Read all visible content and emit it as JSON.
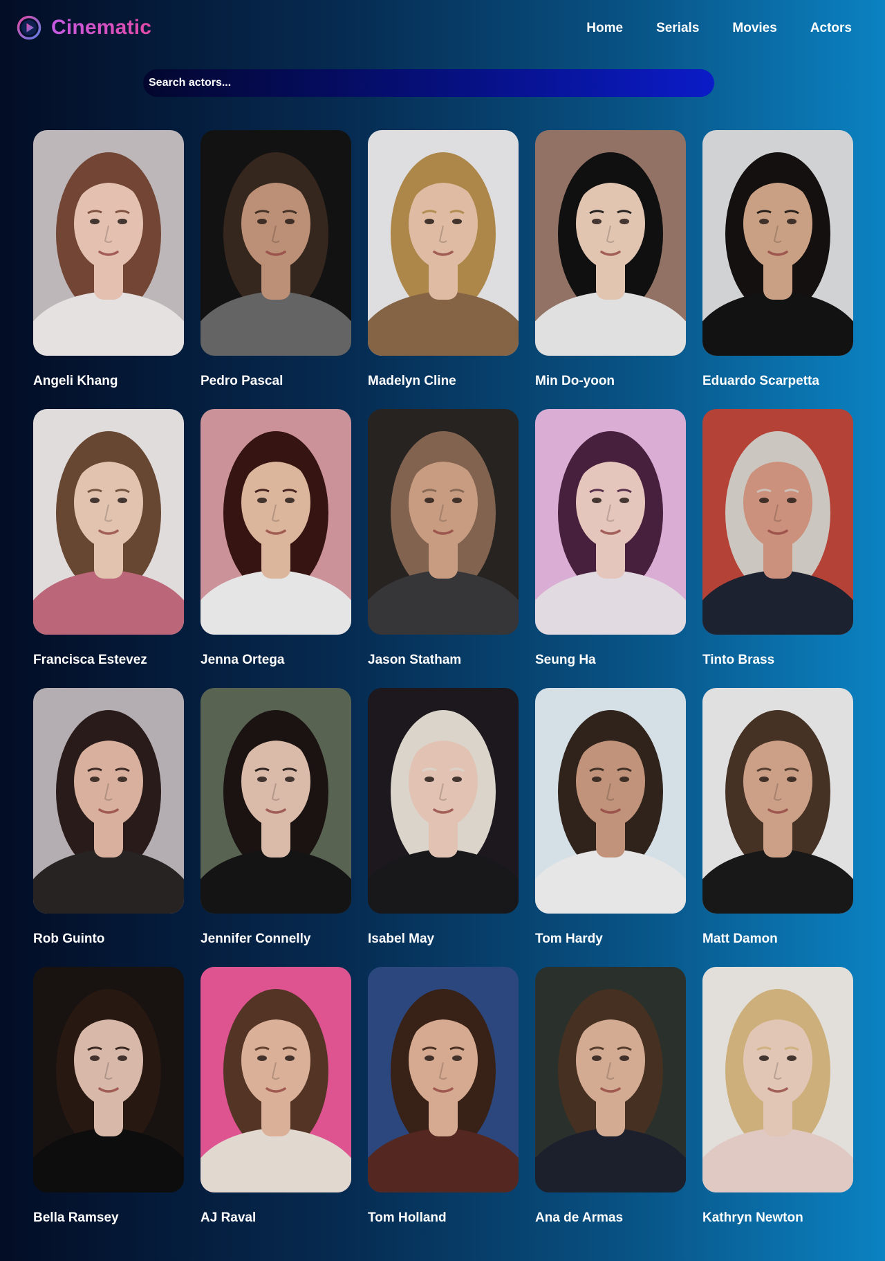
{
  "brand": {
    "name": "Cinematic",
    "icon": "play-circle-icon"
  },
  "nav": [
    {
      "label": "Home"
    },
    {
      "label": "Serials"
    },
    {
      "label": "Movies"
    },
    {
      "label": "Actors"
    }
  ],
  "search": {
    "placeholder": "Search actors...",
    "value": ""
  },
  "actors": [
    {
      "name": "Angeli Khang",
      "bg": "#c9c3c6",
      "skin": "#f2cdbb",
      "hair": "#7b4a38",
      "shirt": "#f4f0ee"
    },
    {
      "name": "Pedro Pascal",
      "bg": "#141414",
      "skin": "#c8997e",
      "hair": "#3a2a20",
      "shirt": "#6b6b6b"
    },
    {
      "name": "Madelyn Cline",
      "bg": "#ecebed",
      "skin": "#ecc7ad",
      "hair": "#b8904e",
      "shirt": "#8d6b4a"
    },
    {
      "name": "Min Do-yoon",
      "bg": "#9c7a6c",
      "skin": "#f0d2bd",
      "hair": "#121212",
      "shirt": "#eeeeee"
    },
    {
      "name": "Eduardo Scarpetta",
      "bg": "#dfe0e2",
      "skin": "#d7ab8d",
      "hair": "#161210",
      "shirt": "#141414"
    },
    {
      "name": "Francisca Estevez",
      "bg": "#efeaea",
      "skin": "#f0d0bc",
      "hair": "#6f4c36",
      "shirt": "#c76d81"
    },
    {
      "name": "Jenna Ortega",
      "bg": "#d89ca3",
      "skin": "#e9c1a6",
      "hair": "#3a1614",
      "shirt": "#f4f4f4"
    },
    {
      "name": "Jason Statham",
      "bg": "#2a2624",
      "skin": "#d5a68a",
      "hair": "#8a6a55",
      "shirt": "#3a3a3c"
    },
    {
      "name": "Seung Ha",
      "bg": "#e8b8e3",
      "skin": "#f4d3c8",
      "hair": "#4c2341",
      "shirt": "#f0e8f0"
    },
    {
      "name": "Tinto Brass",
      "bg": "#c0473b",
      "skin": "#d99b84",
      "hair": "#d8d3cc",
      "shirt": "#1f2535"
    },
    {
      "name": "Rob Guinto",
      "bg": "#c0b9be",
      "skin": "#e6bba7",
      "hair": "#2b1d1b",
      "shirt": "#2b2626"
    },
    {
      "name": "Jennifer Connelly",
      "bg": "#5f6a58",
      "skin": "#e8c6b3",
      "hair": "#1c1514",
      "shirt": "#161616"
    },
    {
      "name": "Isabel May",
      "bg": "#1e1a20",
      "skin": "#f1d0bf",
      "hair": "#e8e2d8",
      "shirt": "#1a1a1c"
    },
    {
      "name": "Tom Hardy",
      "bg": "#e3eef5",
      "skin": "#cc9d82",
      "hair": "#33261e",
      "shirt": "#f5f5f5"
    },
    {
      "name": "Matt Damon",
      "bg": "#efefef",
      "skin": "#d9aa90",
      "hair": "#4a3628",
      "shirt": "#1a1a1a"
    },
    {
      "name": "Bella Ramsey",
      "bg": "#1a1412",
      "skin": "#e6c4b4",
      "hair": "#2a1a14",
      "shirt": "#0e0e0e"
    },
    {
      "name": "AJ Raval",
      "bg": "#ec5a9b",
      "skin": "#e8bba2",
      "hair": "#5a3828",
      "shirt": "#f0e6dc"
    },
    {
      "name": "Tom Holland",
      "bg": "#2e4c86",
      "skin": "#e4b59a",
      "hair": "#3c2418",
      "shirt": "#5a2a22"
    },
    {
      "name": "Ana de Armas",
      "bg": "#2d342e",
      "skin": "#e1b59c",
      "hair": "#4a3324",
      "shirt": "#1e2230"
    },
    {
      "name": "Kathryn Newton",
      "bg": "#f1ede9",
      "skin": "#f1d3c1",
      "hair": "#d9ba82",
      "shirt": "#efd6d0"
    }
  ]
}
